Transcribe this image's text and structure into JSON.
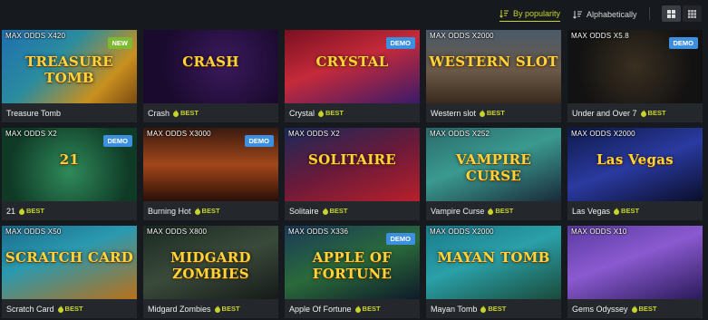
{
  "sort": {
    "popularity_label": "By popularity",
    "alphabetical_label": "Alphabetically"
  },
  "colors": {
    "accent": "#c8d42b",
    "demo_badge": "#3d8fe0",
    "new_badge": "#7fb832",
    "background": "#16191d",
    "card_info": "#24282d"
  },
  "games": [
    {
      "name": "Treasure Tomb",
      "odds": "MAX ODDS X420",
      "badge": "NEW",
      "best": "",
      "art": "TREASURE TOMB",
      "bg": "linear-gradient(135deg,#1f6fb0 0%,#2b8c9e 40%,#c9901e 75%,#7a4a12 100%)"
    },
    {
      "name": "Crash",
      "odds": "",
      "badge": "",
      "best": "BEST",
      "art": "CRASH",
      "bg": "radial-gradient(circle at 60% 45%,#3a1a5c 0%,#1a0a2e 70%)"
    },
    {
      "name": "Crystal",
      "odds": "",
      "badge": "DEMO",
      "best": "BEST",
      "art": "CRYSTAL",
      "bg": "linear-gradient(160deg,#7a1020 0%,#c52a3a 45%,#3a1a6a 100%)"
    },
    {
      "name": "Western slot",
      "odds": "MAX ODDS X2000",
      "badge": "",
      "best": "BEST",
      "art": "WESTERN SLOT",
      "bg": "linear-gradient(180deg,#4a5a6a 0%,#6b5a48 55%,#3a2a1e 100%)"
    },
    {
      "name": "Under and Over 7",
      "odds": "MAX ODDS X5.8",
      "badge": "DEMO",
      "best": "BEST",
      "art": "",
      "bg": "radial-gradient(circle at 50% 50%,#3a2f20 0%,#121212 75%)"
    },
    {
      "name": "21",
      "odds": "MAX ODDS X2",
      "badge": "DEMO",
      "best": "BEST",
      "art": "21",
      "bg": "radial-gradient(circle at 50% 60%,#2f8a5a 0%,#0f3a26 75%)"
    },
    {
      "name": "Burning Hot",
      "odds": "MAX ODDS X3000",
      "badge": "DEMO",
      "best": "BEST",
      "art": "",
      "bg": "linear-gradient(180deg,#3a1a10 0%,#a2471a 50%,#2a0e06 100%)"
    },
    {
      "name": "Solitaire",
      "odds": "MAX ODDS X2",
      "badge": "",
      "best": "BEST",
      "art": "SOLITAIRE",
      "bg": "linear-gradient(160deg,#1a2a5a 0%,#6a1a3a 50%,#b8202a 100%)"
    },
    {
      "name": "Vampire Curse",
      "odds": "MAX ODDS X252",
      "badge": "",
      "best": "BEST",
      "art": "VAMPIRE CURSE",
      "bg": "linear-gradient(160deg,#2a6a6a 0%,#3a9a90 45%,#1a2a3a 100%)"
    },
    {
      "name": "Las Vegas",
      "odds": "MAX ODDS X2000",
      "badge": "",
      "best": "BEST",
      "art": "Las Vegas",
      "bg": "linear-gradient(160deg,#0e1a4a 0%,#2a3aa0 50%,#0a0e2a 100%)"
    },
    {
      "name": "Scratch Card",
      "odds": "MAX ODDS X50",
      "badge": "",
      "best": "BEST",
      "art": "SCRATCH CARD",
      "bg": "linear-gradient(160deg,#1a6a8a 0%,#2a9ab0 40%,#b8701a 100%)"
    },
    {
      "name": "Midgard Zombies",
      "odds": "MAX ODDS X800",
      "badge": "",
      "best": "BEST",
      "art": "MIDGARD ZOMBIES",
      "bg": "linear-gradient(160deg,#1a2a22 0%,#3a4a3a 50%,#151a18 100%)"
    },
    {
      "name": "Apple Of Fortune",
      "odds": "MAX ODDS X336",
      "badge": "DEMO",
      "best": "BEST",
      "art": "APPLE OF FORTUNE",
      "bg": "linear-gradient(160deg,#1a3a5a 0%,#2a6a3a 50%,#0e1a2a 100%)"
    },
    {
      "name": "Mayan Tomb",
      "odds": "MAX ODDS X2000",
      "badge": "",
      "best": "BEST",
      "art": "MAYAN TOMB",
      "bg": "linear-gradient(160deg,#1a7a8a 0%,#2aa0a8 45%,#1a4a3a 100%)"
    },
    {
      "name": "Gems Odyssey",
      "odds": "MAX ODDS X10",
      "badge": "",
      "best": "BEST",
      "art": "",
      "bg": "linear-gradient(160deg,#5a3aa0 0%,#8a5ad0 45%,#2a1a5a 100%)"
    }
  ]
}
